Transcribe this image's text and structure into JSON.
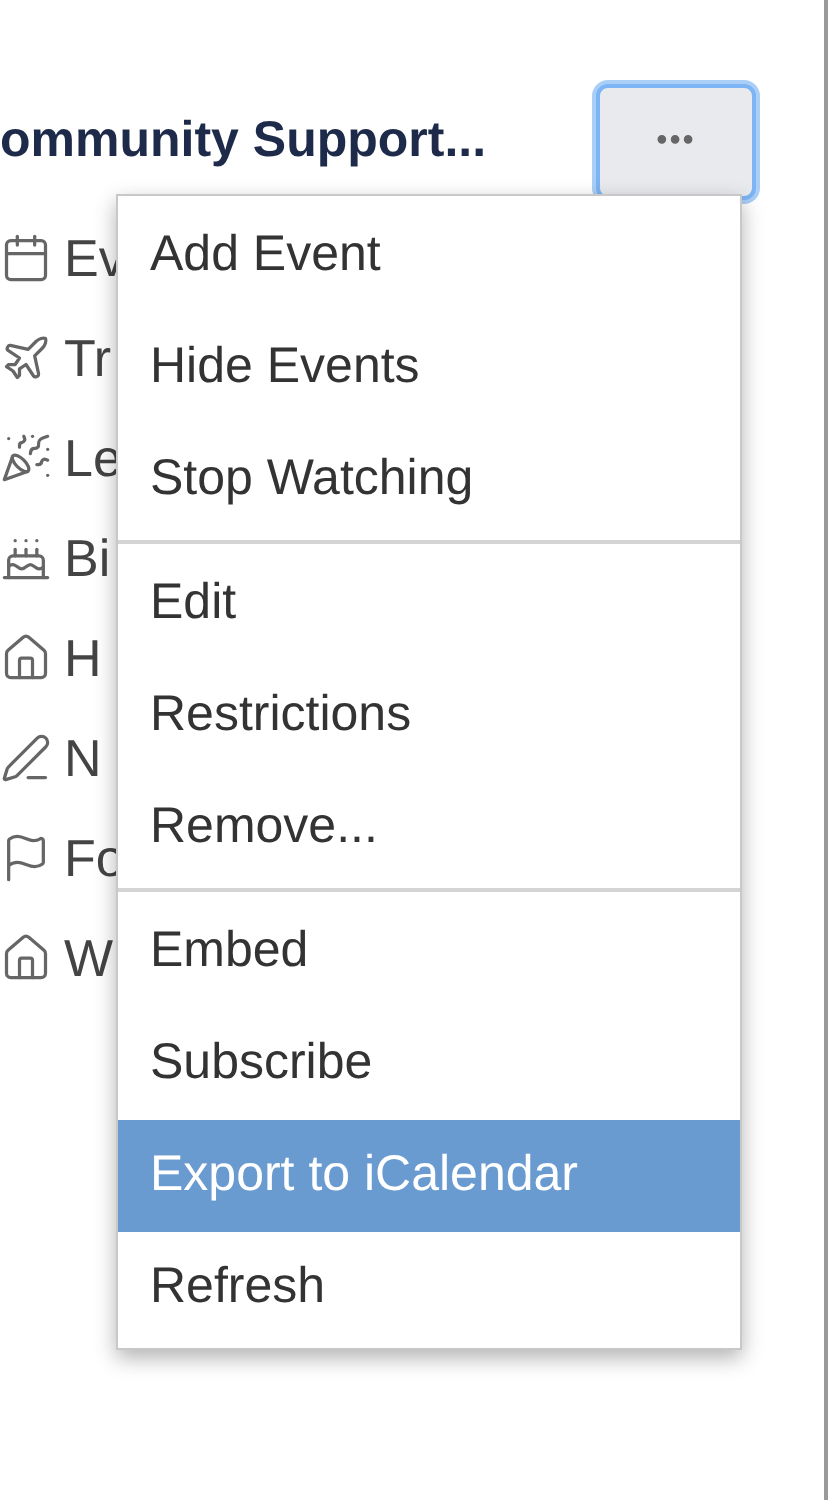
{
  "header": {
    "title": "ommunity Support..."
  },
  "more_button": {
    "label": "•••",
    "focused": true
  },
  "calendar_list": [
    {
      "label": "Ev"
    },
    {
      "label": "Tr"
    },
    {
      "label": "Le"
    },
    {
      "label": "Bi"
    },
    {
      "label": "H"
    },
    {
      "label": "N"
    },
    {
      "label": "Fo"
    },
    {
      "label": "W"
    }
  ],
  "menu": {
    "groups": [
      [
        {
          "label": "Add Event",
          "selected": false
        },
        {
          "label": "Hide Events",
          "selected": false
        },
        {
          "label": "Stop Watching",
          "selected": false
        }
      ],
      [
        {
          "label": "Edit",
          "selected": false
        },
        {
          "label": "Restrictions",
          "selected": false
        },
        {
          "label": "Remove...",
          "selected": false
        }
      ],
      [
        {
          "label": "Embed",
          "selected": false
        },
        {
          "label": "Subscribe",
          "selected": false
        },
        {
          "label": "Export to iCalendar",
          "selected": true
        },
        {
          "label": "Refresh",
          "selected": false
        }
      ]
    ]
  }
}
